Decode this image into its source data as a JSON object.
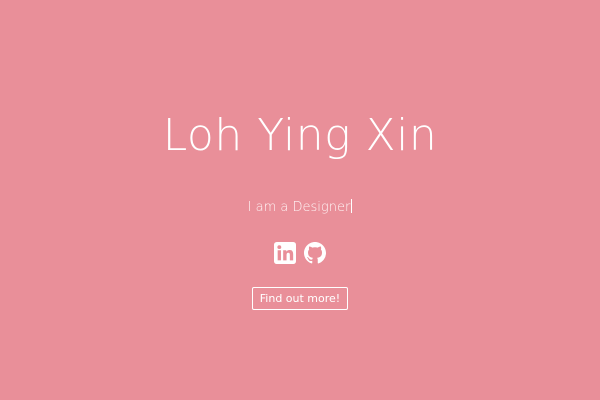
{
  "hero": {
    "name": "Loh Ying Xin",
    "tagline": "I am a Designer",
    "cta_label": "Find out more!"
  },
  "social": {
    "linkedin_icon": "linkedin-icon",
    "github_icon": "github-icon"
  },
  "colors": {
    "background": "#e98f99",
    "text": "#ffffff"
  }
}
